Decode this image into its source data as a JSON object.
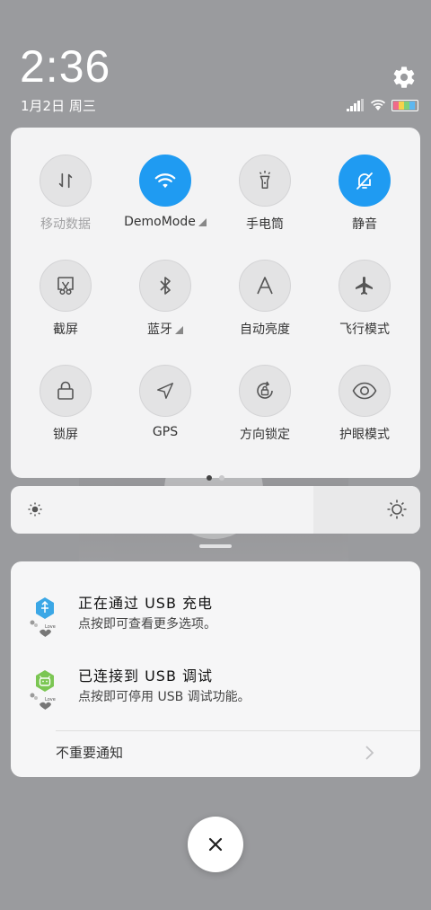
{
  "status": {
    "time": "2:36",
    "date": "1月2日 周三"
  },
  "icons": {
    "settings": "gear-icon",
    "signal": "signal-icon",
    "wifi": "wifi-icon",
    "battery": "battery-icon"
  },
  "colors": {
    "accent": "#1f9bf2",
    "panel": "#f3f3f4",
    "inactive_tile": "#e3e3e4"
  },
  "tiles": [
    {
      "label": "移动数据",
      "icon": "data-arrows-icon",
      "active": false,
      "disabled": true
    },
    {
      "label": "DemoMode",
      "icon": "wifi-icon",
      "active": true,
      "expandable": true
    },
    {
      "label": "手电筒",
      "icon": "flashlight-icon",
      "active": false
    },
    {
      "label": "静音",
      "icon": "bell-off-icon",
      "active": true
    },
    {
      "label": "截屏",
      "icon": "screenshot-icon",
      "active": false
    },
    {
      "label": "蓝牙",
      "icon": "bluetooth-icon",
      "active": false,
      "expandable": true
    },
    {
      "label": "自动亮度",
      "icon": "auto-brightness-icon",
      "active": false
    },
    {
      "label": "飞行模式",
      "icon": "airplane-icon",
      "active": false
    },
    {
      "label": "锁屏",
      "icon": "lock-icon",
      "active": false
    },
    {
      "label": "GPS",
      "icon": "location-arrow-icon",
      "active": false
    },
    {
      "label": "方向锁定",
      "icon": "rotation-lock-icon",
      "active": false
    },
    {
      "label": "护眼模式",
      "icon": "eye-icon",
      "active": false
    }
  ],
  "pager": {
    "pages": 2,
    "current": 1
  },
  "brightness": {
    "level": 0.74
  },
  "notifications": [
    {
      "title": "正在通过 USB 充电",
      "body": "点按即可查看更多选项。",
      "icon": "usb-charge-app-icon"
    },
    {
      "title": "已连接到 USB 调试",
      "body": "点按即可停用 USB 调试功能。",
      "icon": "android-debug-app-icon"
    }
  ],
  "unimportant_label": "不重要通知",
  "app_badge_text": "Love"
}
